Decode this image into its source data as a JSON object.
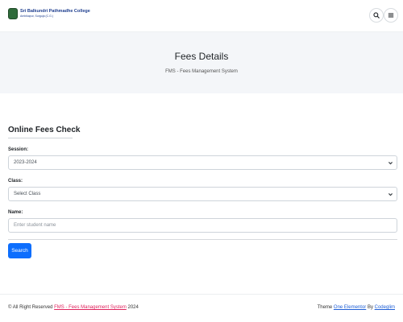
{
  "header": {
    "logo_line1": "Sri Balkundri Pathmadhe College",
    "logo_line2": "Ambikapur, Surguja (C.G.)",
    "search_icon": "search-icon",
    "menu_icon": "menu-icon"
  },
  "hero": {
    "title": "Fees Details",
    "subtitle": "FMS - Fees Management System"
  },
  "form": {
    "title": "Online Fees Check",
    "session_label": "Session:",
    "session_value": "2023-2024",
    "class_label": "Class:",
    "class_value": "Select Class",
    "name_label": "Name:",
    "name_placeholder": "Enter student name",
    "search_button": "Search"
  },
  "footer": {
    "copyright_prefix": "© All Right Reserved",
    "site_link": "FMS - Fees Management System",
    "year": "2024",
    "theme_prefix": "Theme",
    "theme_link": "One Elementor",
    "by_text": "By",
    "author_link": "Codeglim"
  },
  "colors": {
    "accent": "#0d6efd",
    "hero_bg": "#f4f6f9",
    "footer_link_pink": "#e0245e",
    "footer_link_blue": "#1f5fd6"
  }
}
